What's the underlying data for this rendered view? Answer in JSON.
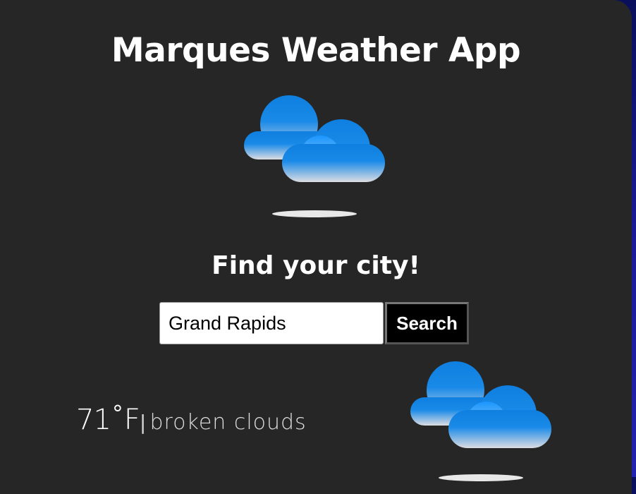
{
  "app": {
    "title": "Marques Weather App"
  },
  "hero": {
    "icon": "broken-clouds-icon"
  },
  "search": {
    "heading": "Find your city!",
    "input_value": "Grand Rapids",
    "button_label": "Search"
  },
  "current": {
    "temperature": "71˚F",
    "separator": "|",
    "description": "broken clouds",
    "icon": "broken-clouds-icon"
  },
  "colors": {
    "card_background": "#272627",
    "page_background": "#1a1a9a",
    "cloud_top": "#1183e0",
    "cloud_bottom": "#d8dadf"
  }
}
